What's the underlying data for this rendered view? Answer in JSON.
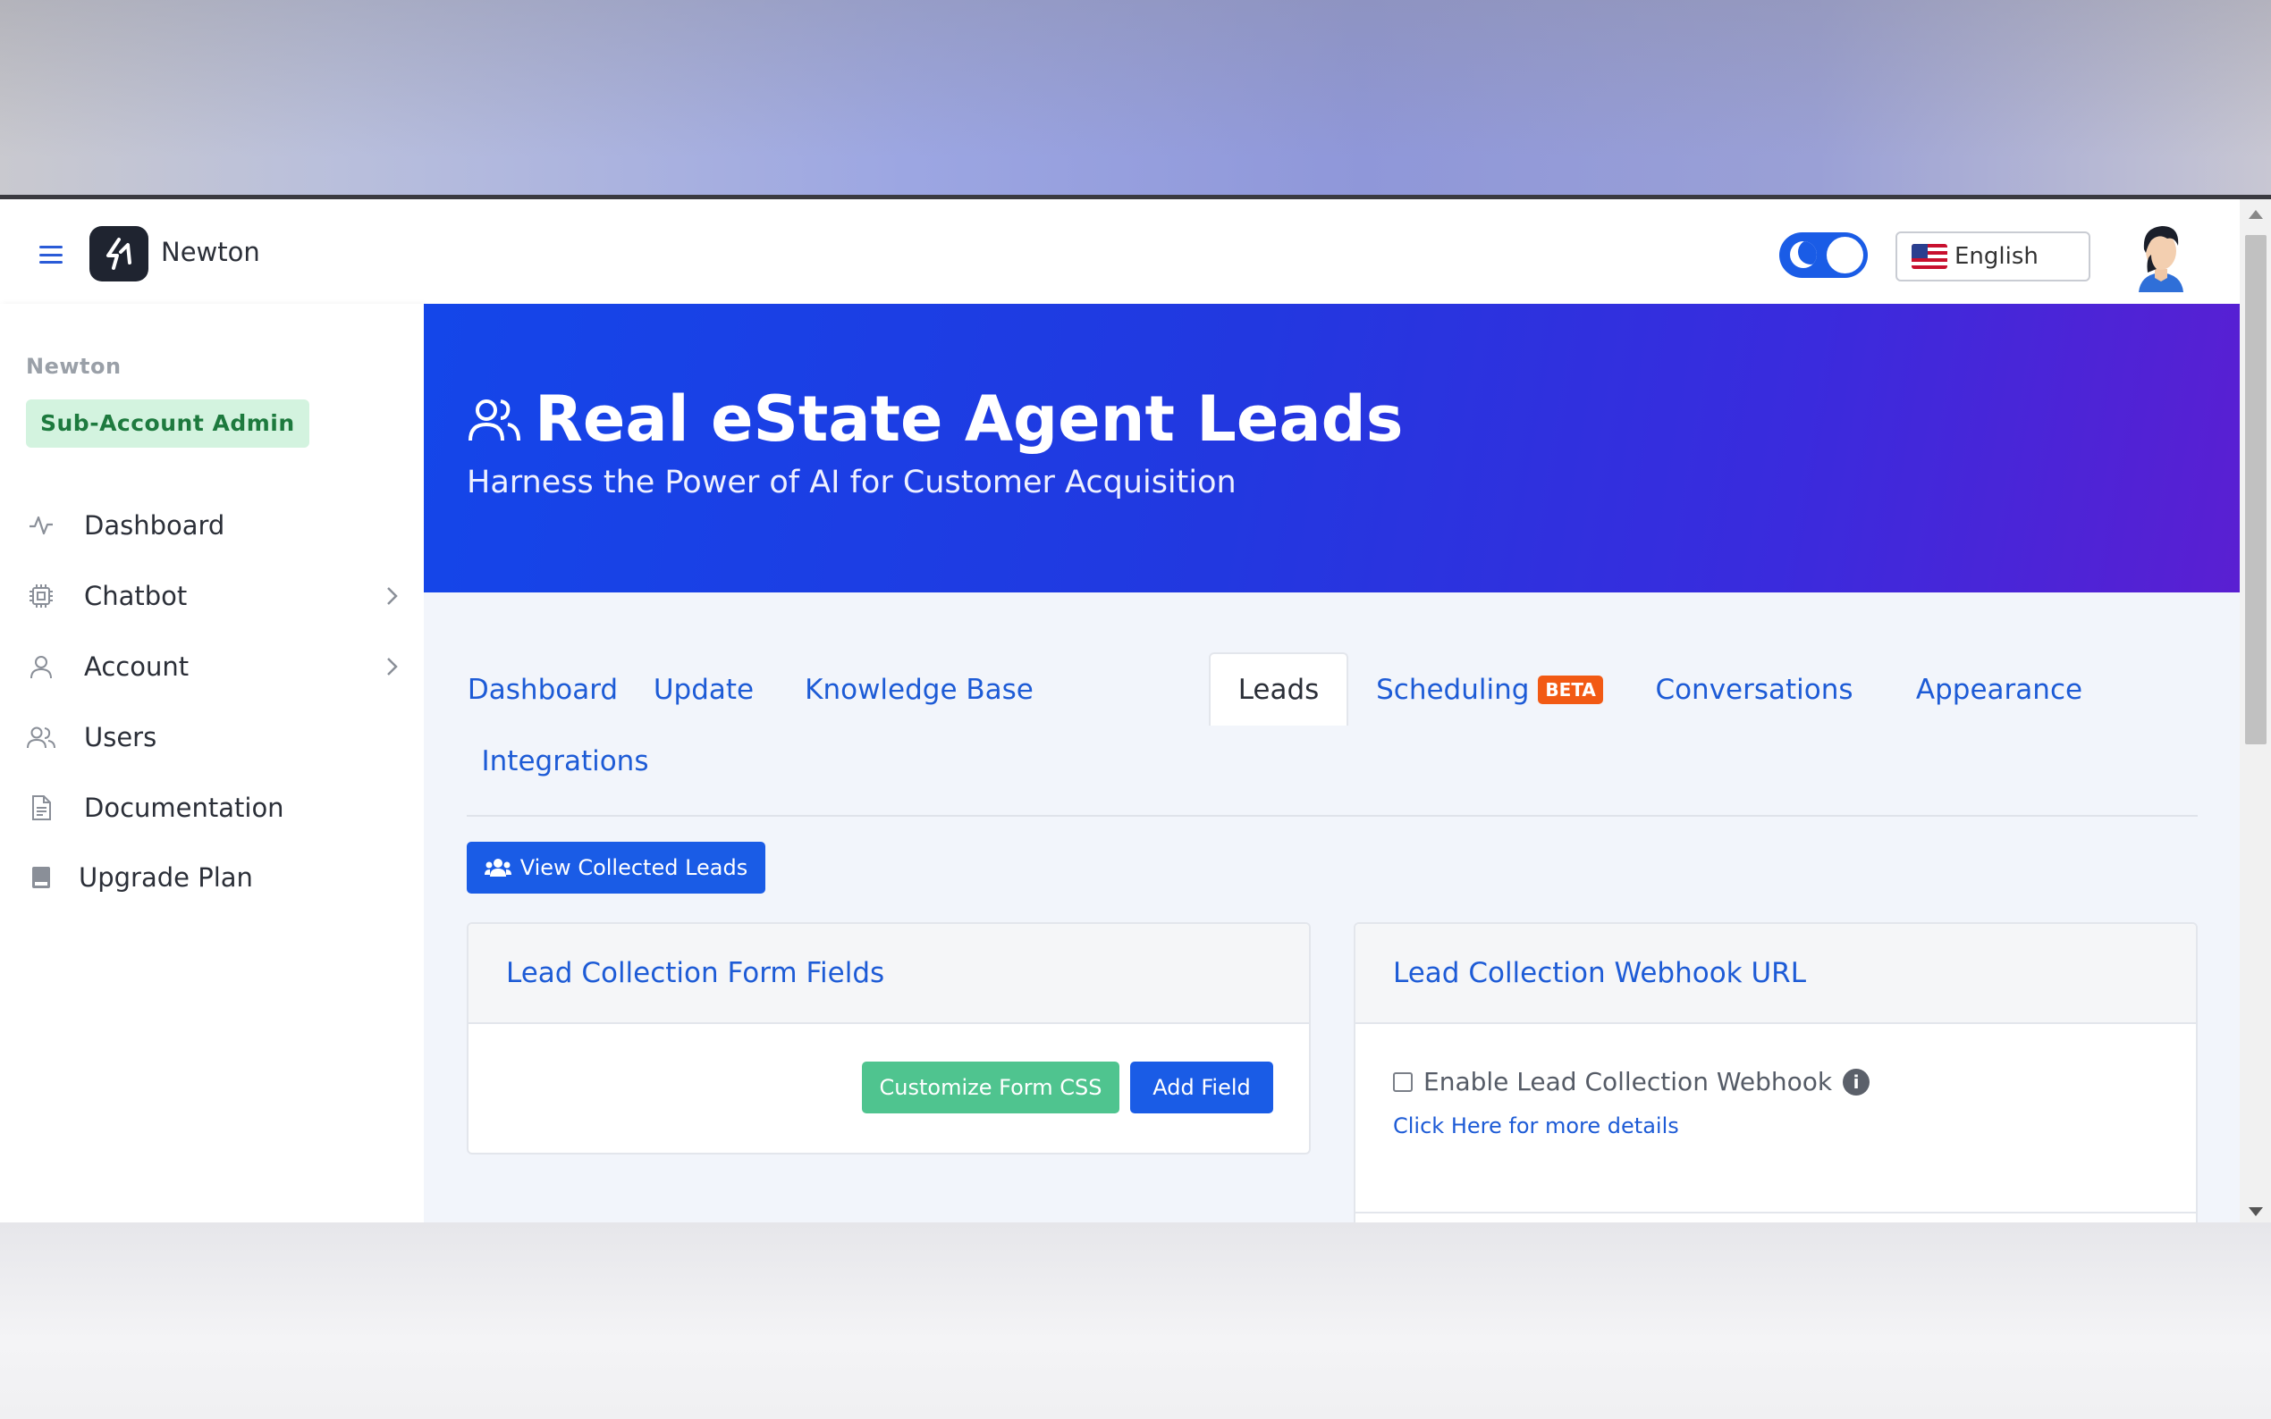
{
  "app": {
    "brand_name": "Newton",
    "language": "English"
  },
  "sidebar": {
    "org_name": "Newton",
    "role_badge": "Sub-Account Admin",
    "items": [
      {
        "label": "Dashboard",
        "icon": "activity-icon",
        "has_submenu": false
      },
      {
        "label": "Chatbot",
        "icon": "chip-icon",
        "has_submenu": true
      },
      {
        "label": "Account",
        "icon": "user-icon",
        "has_submenu": true
      },
      {
        "label": "Users",
        "icon": "users-icon",
        "has_submenu": false
      },
      {
        "label": "Documentation",
        "icon": "document-icon",
        "has_submenu": false
      },
      {
        "label": "Upgrade Plan",
        "icon": "book-icon",
        "has_submenu": false
      }
    ]
  },
  "hero": {
    "title": "Real eState Agent Leads",
    "subtitle": "Harness the Power of AI for Customer Acquisition"
  },
  "tabs": [
    {
      "label": "Dashboard"
    },
    {
      "label": "Update"
    },
    {
      "label": "Knowledge Base"
    },
    {
      "label": "Leads",
      "active": true
    },
    {
      "label": "Scheduling",
      "badge": "BETA"
    },
    {
      "label": "Conversations"
    },
    {
      "label": "Appearance"
    },
    {
      "label": "Integrations"
    }
  ],
  "actions": {
    "view_leads": "View Collected Leads"
  },
  "form_fields_card": {
    "title": "Lead Collection Form Fields",
    "customize_css": "Customize Form CSS",
    "add_field": "Add Field"
  },
  "webhook_card": {
    "title": "Lead Collection Webhook URL",
    "enable_label": "Enable Lead Collection Webhook",
    "enabled": false,
    "details_link": "Click Here for more details"
  },
  "colors": {
    "primary": "#1a5ce6",
    "success": "#4fc48f",
    "beta": "#f25a14",
    "hero_start": "#1446e9",
    "hero_end": "#5a1fd2"
  }
}
